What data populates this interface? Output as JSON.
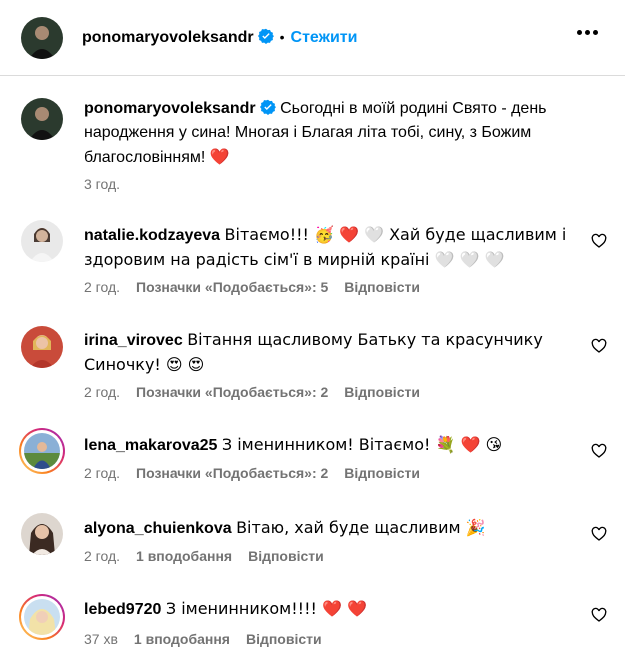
{
  "post": {
    "author": "ponomaryovoleksandr",
    "separator": "•",
    "follow_label": "Стежити",
    "caption_text": "Сьогодні в моїй родині Свято - день народження у сина! Многая і Благая літа тобі, сину, з Божим благословінням!",
    "caption_emoji": "❤️",
    "time": "3 год."
  },
  "comments": [
    {
      "user": "natalie.kodzayeva",
      "line1": "Вітаємо!!! 🥳 ❤️ 🤍 Хай буде щасливим і",
      "line2": "здоровим на радість сім'ї в мирній країні 🤍 🤍 🤍",
      "time": "2 год.",
      "likes": "Позначки «Подобається»: 5",
      "reply": "Відповісти"
    },
    {
      "user": "irina_virovec",
      "line1": "Вітання щасливому Батьку та красунчику",
      "line2": "Синочку! 😍 😍",
      "time": "2 год.",
      "likes": "Позначки «Подобається»: 2",
      "reply": "Відповісти"
    },
    {
      "user": "lena_makarova25",
      "line1": "З іменинником! Вітаємо! 💐 ❤️ 😘",
      "time": "2 год.",
      "likes": "Позначки «Подобається»: 2",
      "reply": "Відповісти"
    },
    {
      "user": "alyona_chuienkova",
      "line1": "Вітаю, хай буде щасливим 🎉",
      "time": "2 год.",
      "likes": "1 вподобання",
      "reply": "Відповісти"
    },
    {
      "user": "lebed9720",
      "line1": "З іменинником!!!! ❤️ ❤️",
      "time": "37 хв",
      "likes": "1 вподобання",
      "reply": "Відповісти"
    }
  ],
  "colors": {
    "link_blue": "#0095f6",
    "verified_blue": "#0095f6",
    "meta_gray": "#737373",
    "heart_red": "#ed4956"
  },
  "icons": [
    "more-options-icon",
    "verified-badge-icon",
    "like-heart-icon"
  ]
}
